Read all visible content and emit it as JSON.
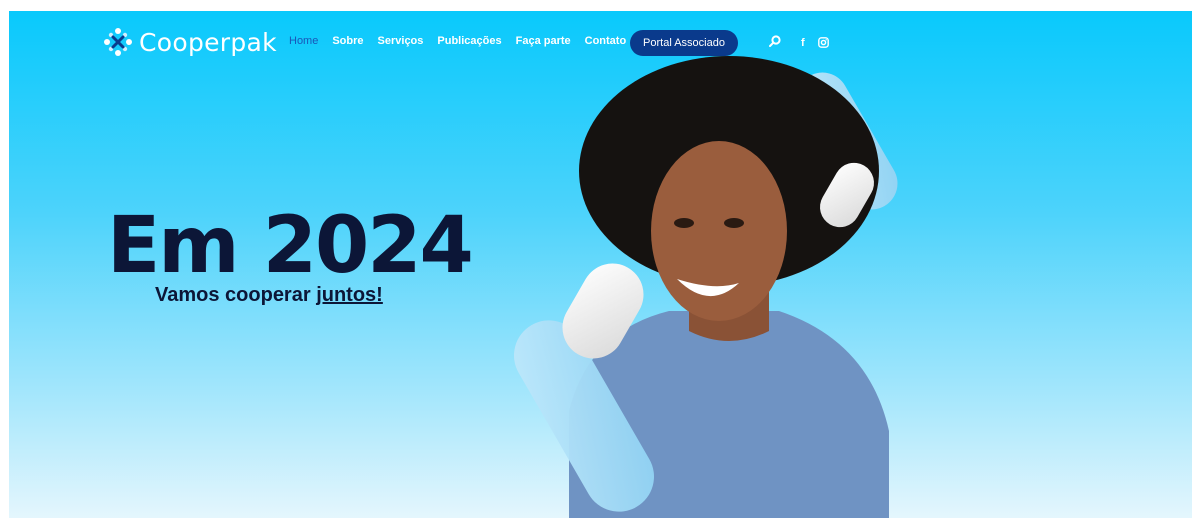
{
  "brand": {
    "name": "Cooperpak"
  },
  "nav": {
    "items": [
      {
        "label": "Home"
      },
      {
        "label": "Sobre"
      },
      {
        "label": "Serviços"
      },
      {
        "label": "Publicações"
      },
      {
        "label": "Faça parte"
      },
      {
        "label": "Contato"
      }
    ],
    "portal_button": "Portal Associado"
  },
  "hero": {
    "headline": "Em 2024",
    "sub_prefix": "Vamos cooperar ",
    "sub_highlight": "juntos!"
  },
  "icons": [
    "logo-mark-icon",
    "search-icon",
    "facebook-icon",
    "instagram-icon"
  ],
  "colors": {
    "accent": "#0a3a8c",
    "headline": "#0c1637",
    "hero_top": "#09c9fc",
    "hero_bottom": "#e4f6fd",
    "active_nav": "#1a56b8"
  }
}
